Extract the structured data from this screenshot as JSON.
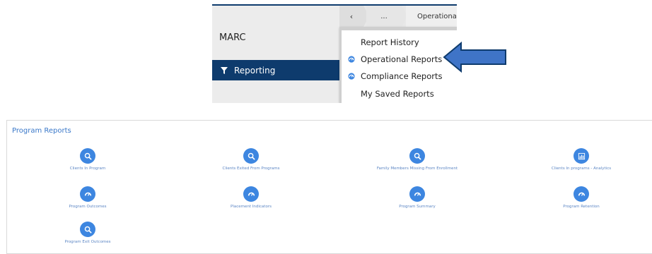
{
  "top": {
    "org_name": "MARC",
    "nav_reporting_label": "Reporting",
    "breadcrumb": {
      "back": "‹",
      "ellipsis": "...",
      "current": "Operational Reports"
    },
    "menu": {
      "items": [
        {
          "label": "Report History",
          "icon": null
        },
        {
          "label": "Operational Reports",
          "icon": "dashboard-gauge-icon"
        },
        {
          "label": "Compliance Reports",
          "icon": "dashboard-gauge-icon"
        },
        {
          "label": "My Saved Reports",
          "icon": null
        }
      ]
    },
    "annotation_arrow_color": "#3f74c7"
  },
  "program_reports": {
    "title": "Program Reports",
    "accent_color": "#3d86e0",
    "tiles": [
      {
        "label": "Clients In Program",
        "icon": "search-icon"
      },
      {
        "label": "Clients Exited From Programs",
        "icon": "search-icon"
      },
      {
        "label": "Family Members Missing From Enrollment",
        "icon": "search-icon"
      },
      {
        "label": "Clients In programs - Analytics",
        "icon": "bar-chart-icon"
      },
      {
        "label": "Program Outcomes",
        "icon": "dashboard-gauge-icon"
      },
      {
        "label": "Placement Indicators",
        "icon": "dashboard-gauge-icon"
      },
      {
        "label": "Program Summary",
        "icon": "dashboard-gauge-icon"
      },
      {
        "label": "Program Retention",
        "icon": "dashboard-gauge-icon"
      },
      {
        "label": "Program Exit Outcomes",
        "icon": "search-icon"
      }
    ]
  }
}
